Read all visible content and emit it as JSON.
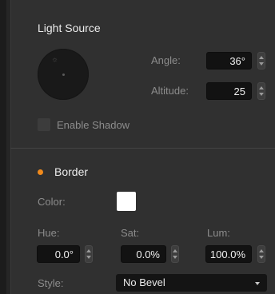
{
  "light_source": {
    "title": "Light Source",
    "angle_label": "Angle:",
    "angle_value": "36°",
    "altitude_label": "Altitude:",
    "altitude_value": "25",
    "enable_shadow_label": "Enable Shadow",
    "enable_shadow_checked": false
  },
  "border": {
    "title": "Border",
    "bullet_color": "#f08a1c",
    "color_label": "Color:",
    "color_value": "#ffffff",
    "hue_label": "Hue:",
    "hue_value": "0.0°",
    "sat_label": "Sat:",
    "sat_value": "0.0%",
    "lum_label": "Lum:",
    "lum_value": "100.0%",
    "style_label": "Style:",
    "style_value": "No Bevel"
  }
}
